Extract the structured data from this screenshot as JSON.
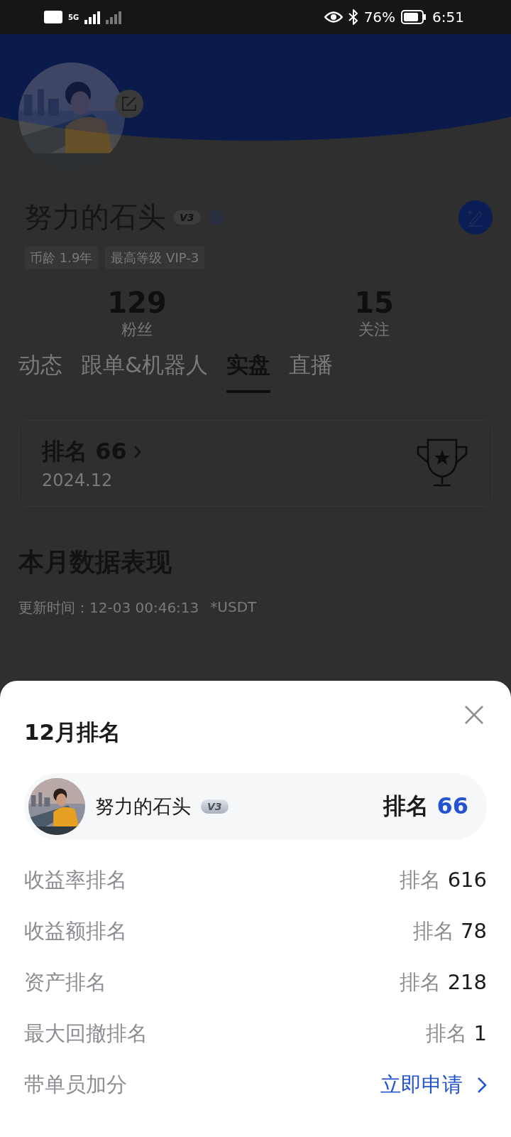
{
  "status_bar": {
    "network": "5G",
    "battery": "76%",
    "time": "6:51"
  },
  "profile": {
    "name": "努力的石头",
    "level_badge": "V3",
    "tags": [
      "币龄 1.9年",
      "最高等级 VIP-3"
    ],
    "stats": [
      {
        "value": "129",
        "label": "粉丝"
      },
      {
        "value": "15",
        "label": "关注"
      }
    ],
    "tabs": [
      {
        "label": "动态",
        "selected": false
      },
      {
        "label": "跟单&机器人",
        "selected": false
      },
      {
        "label": "实盘",
        "selected": true
      },
      {
        "label": "直播",
        "selected": false
      }
    ],
    "rank_card": {
      "label": "排名",
      "value": "66",
      "period": "2024.12"
    },
    "section": {
      "title": "本月数据表现",
      "updated": "更新时间：12-03 00:46:13",
      "unit": "*USDT"
    }
  },
  "sheet": {
    "title": "12月排名",
    "user": {
      "name": "努力的石头",
      "badge": "V3",
      "rank_label": "排名",
      "rank_value": "66"
    },
    "rows": [
      {
        "kind": "rank",
        "label": "收益率排名",
        "prefix": "排名",
        "value": "616"
      },
      {
        "kind": "rank",
        "label": "收益额排名",
        "prefix": "排名",
        "value": "78"
      },
      {
        "kind": "rank",
        "label": "资产排名",
        "prefix": "排名",
        "value": "218"
      },
      {
        "kind": "rank",
        "label": "最大回撤排名",
        "prefix": "排名",
        "value": "1"
      },
      {
        "kind": "link",
        "label": "带单员加分",
        "action": "立即申请"
      }
    ]
  }
}
